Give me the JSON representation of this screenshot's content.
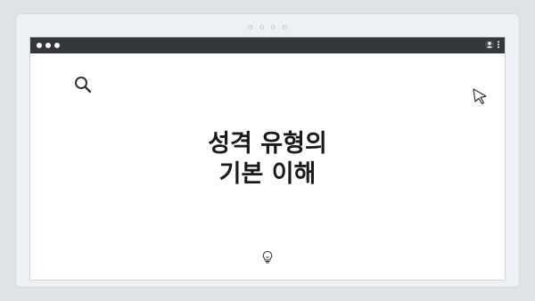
{
  "window": {
    "title_line_1": "성격 유형의",
    "title_line_2": "기본 이해"
  },
  "icons": {
    "search": "search-icon",
    "cursor": "cursor-arrow-icon",
    "bulb": "lightbulb-icon",
    "user": "user-icon",
    "menu": "kebab-menu-icon"
  },
  "colors": {
    "titlebar": "#34373b",
    "background": "#dfe3e8",
    "text": "#1a1a1a"
  }
}
